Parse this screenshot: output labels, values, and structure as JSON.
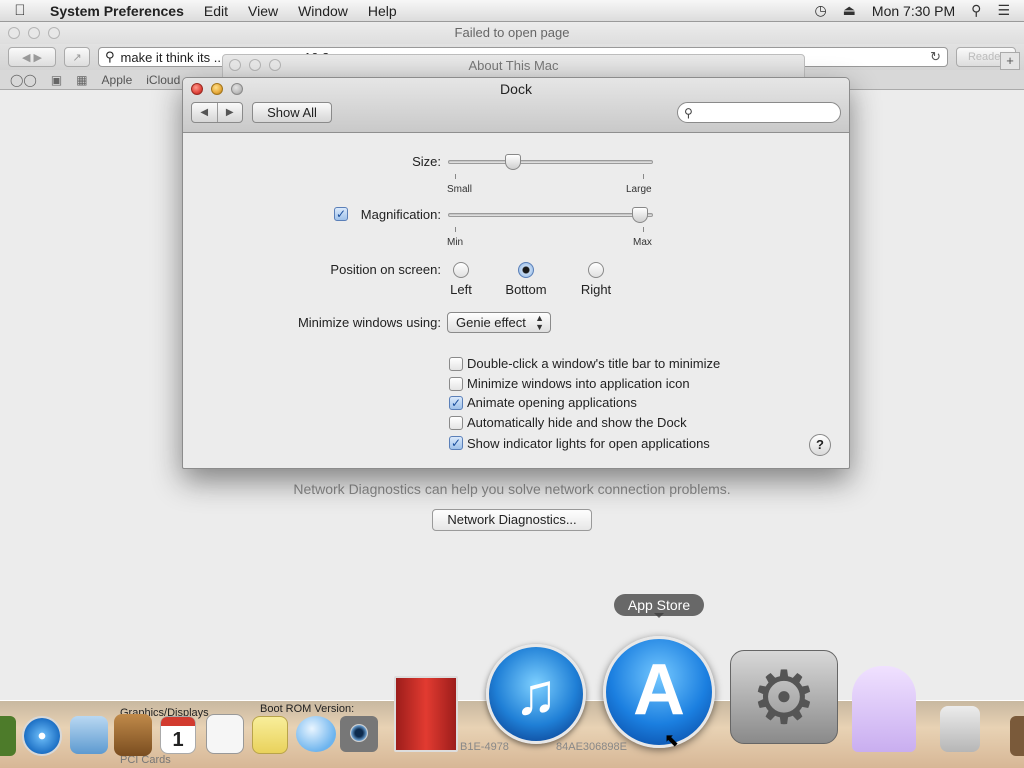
{
  "menubar": {
    "app_name": "System Preferences",
    "items": [
      "Edit",
      "View",
      "Window",
      "Help"
    ],
    "clock": "Mon 7:30 PM"
  },
  "browser": {
    "title": "Failed to open page",
    "url": "make it think its ... n ... a ... o ... 10.8",
    "reader": "Reader",
    "bookmarks": [
      "Apple",
      "iCloud"
    ],
    "network_text": "Network Diagnostics can help you solve network connection problems.",
    "network_button": "Network Diagnostics..."
  },
  "about_window": {
    "title": "About This Mac"
  },
  "dock_prefs": {
    "title": "Dock",
    "show_all": "Show All",
    "search_placeholder": "",
    "size": {
      "label": "Size:",
      "min_label": "Small",
      "max_label": "Large",
      "value": 0.3
    },
    "magnification": {
      "label": "Magnification:",
      "checked": true,
      "min_label": "Min",
      "max_label": "Max",
      "value": 0.98
    },
    "position": {
      "label": "Position on screen:",
      "options": [
        "Left",
        "Bottom",
        "Right"
      ],
      "selected": "Bottom"
    },
    "minimize": {
      "label": "Minimize windows using:",
      "value": "Genie effect"
    },
    "checkboxes": [
      {
        "label": "Double-click a window's title bar to minimize",
        "checked": false
      },
      {
        "label": "Minimize windows into application icon",
        "checked": false
      },
      {
        "label": "Animate opening applications",
        "checked": true
      },
      {
        "label": "Automatically hide and show the Dock",
        "checked": false
      },
      {
        "label": "Show indicator lights for open applications",
        "checked": true
      }
    ],
    "help": "?"
  },
  "dock": {
    "tooltip": "App Store",
    "info_left": [
      "Graphics/Displays",
      "PCI Cards"
    ],
    "info_mid": [
      "Boot ROM Version:"
    ],
    "info_right": [
      "B1E-4978",
      "84AE306898E"
    ],
    "cal_day": "1"
  }
}
